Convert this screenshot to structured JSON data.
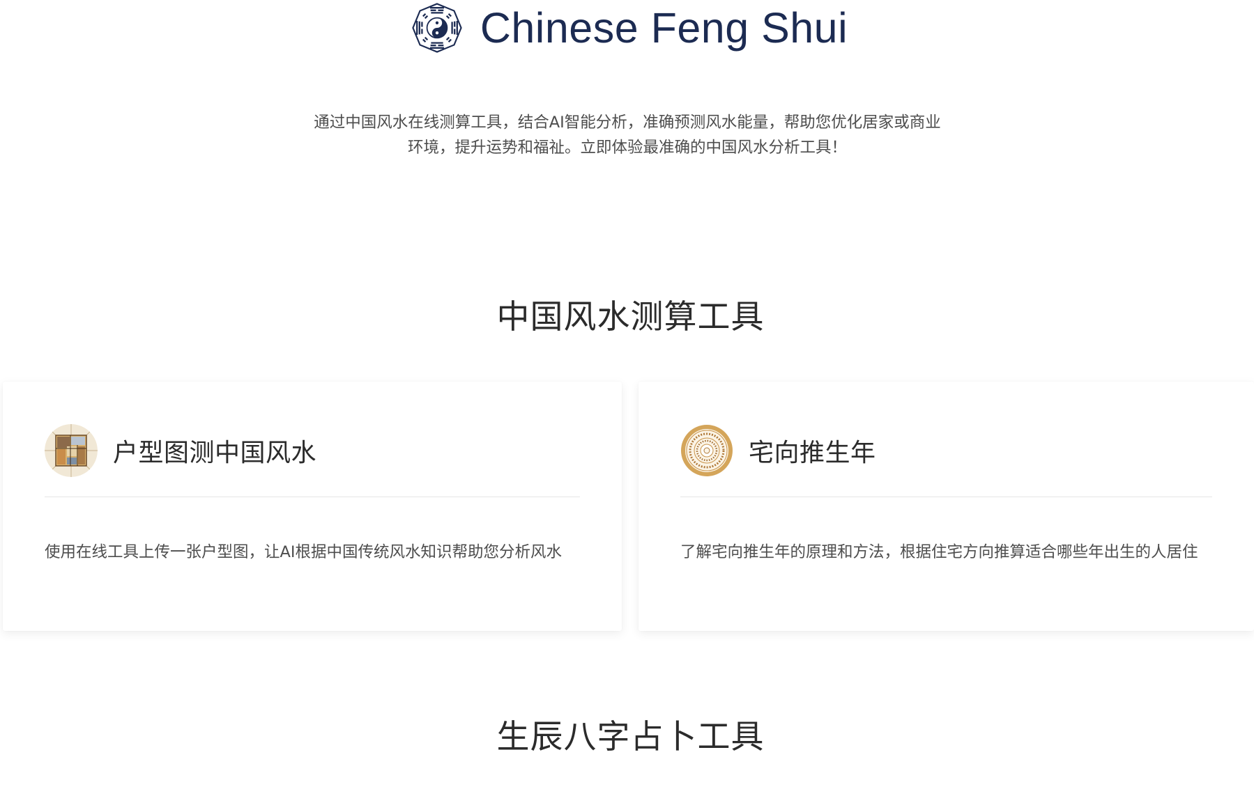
{
  "header": {
    "title": "Chinese Feng Shui",
    "logo_icon": "bagua-icon"
  },
  "intro": {
    "text": "通过中国风水在线测算工具，结合AI智能分析，准确预测风水能量，帮助您优化居家或商业环境，提升运势和福祉。立即体验最准确的中国风水分析工具！"
  },
  "sections": [
    {
      "title": "中国风水测算工具",
      "cards": [
        {
          "title": "户型图测中国风水",
          "description": "使用在线工具上传一张户型图，让AI根据中国传统风水知识帮助您分析风水",
          "icon": "floor-plan-icon"
        },
        {
          "title": "宅向推生年",
          "description": "了解宅向推生年的原理和方法，根据住宅方向推算适合哪些年出生的人居住",
          "icon": "luopan-compass-icon"
        }
      ]
    },
    {
      "title": "生辰八字占卜工具"
    }
  ],
  "colors": {
    "brand_navy": "#1c2b52",
    "text_dark": "#2b2b2b",
    "text_body": "#4d4d4d",
    "divider": "#e6e6e6",
    "compass_gold": "#d4a55a"
  }
}
